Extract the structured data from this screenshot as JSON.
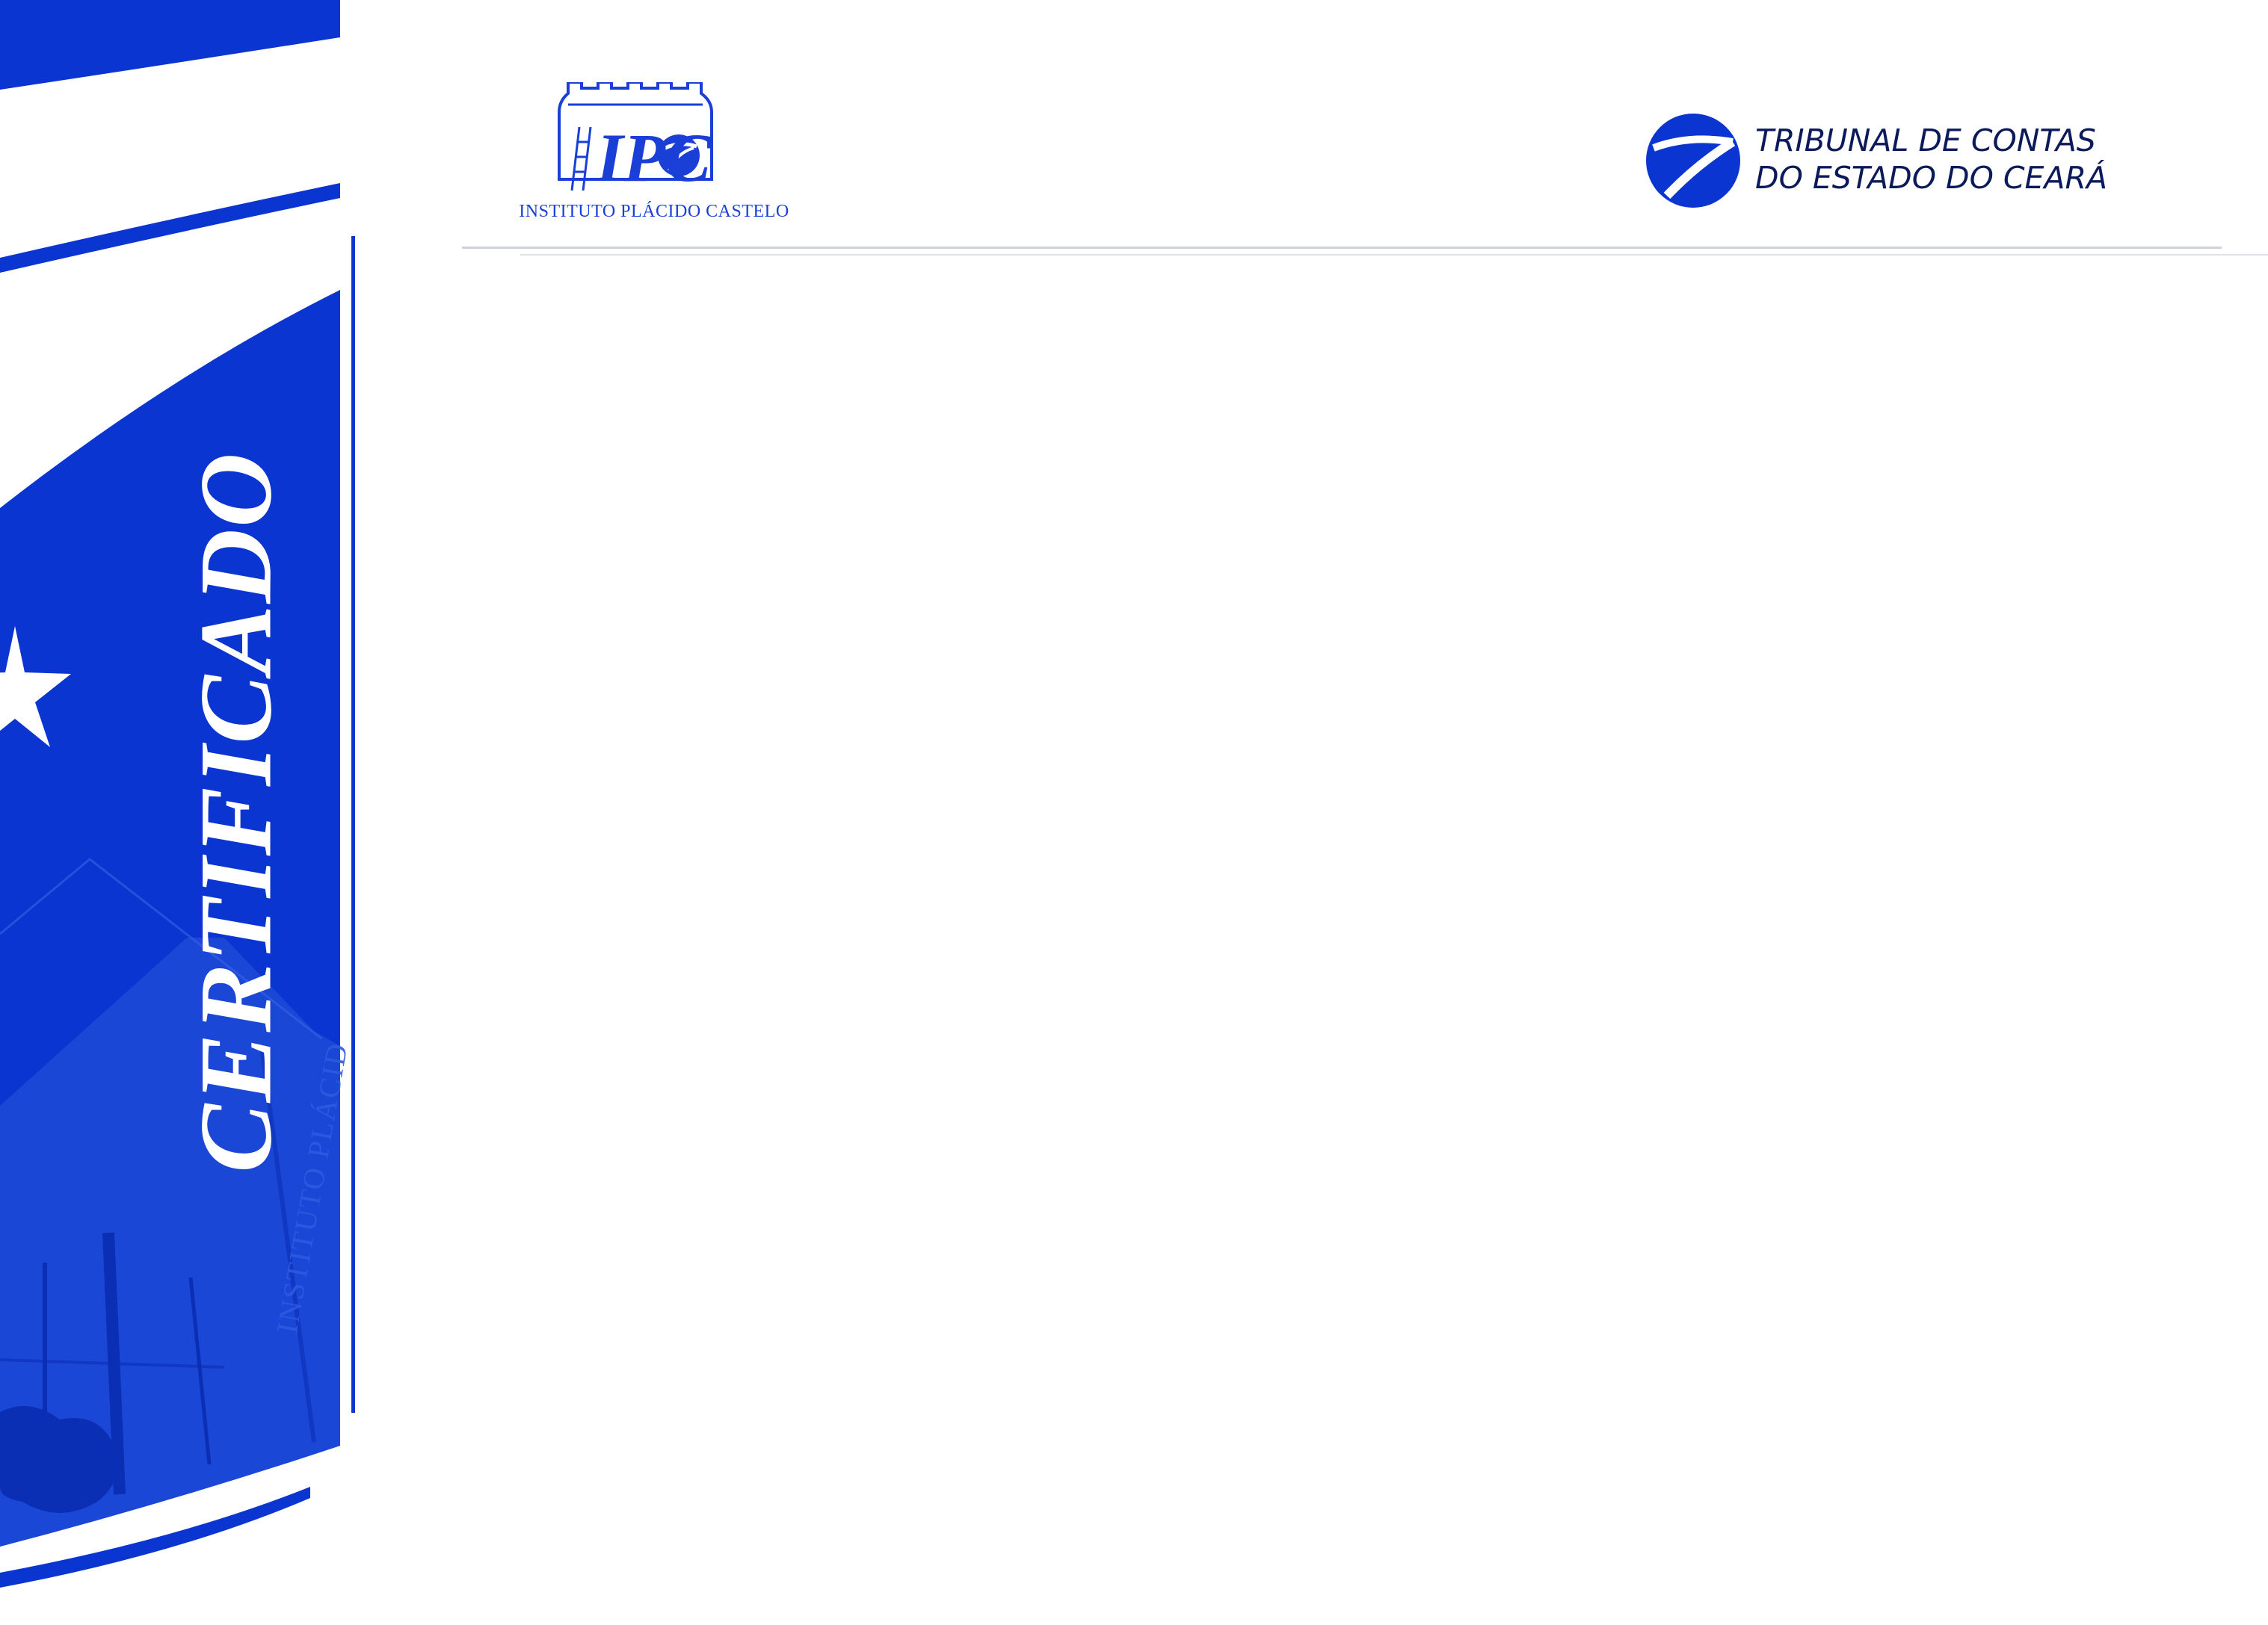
{
  "certificate": {
    "title": "CERTIFICADO",
    "watermark": "INSTITUTO PLÁCID"
  },
  "left_logo": {
    "monogram": "IPC",
    "caption": "INSTITUTO PLÁCIDO CASTELO",
    "icon": "castle-tower-icon"
  },
  "right_logo": {
    "line1": "TRIBUNAL DE CONTAS",
    "line2": "DO ESTADO DO CEARÁ",
    "icon": "tce-emblem-icon"
  },
  "colors": {
    "brand_blue": "#0a35d0",
    "logo_blue": "#1a3fd6",
    "text_navy": "#0b1a5a"
  }
}
